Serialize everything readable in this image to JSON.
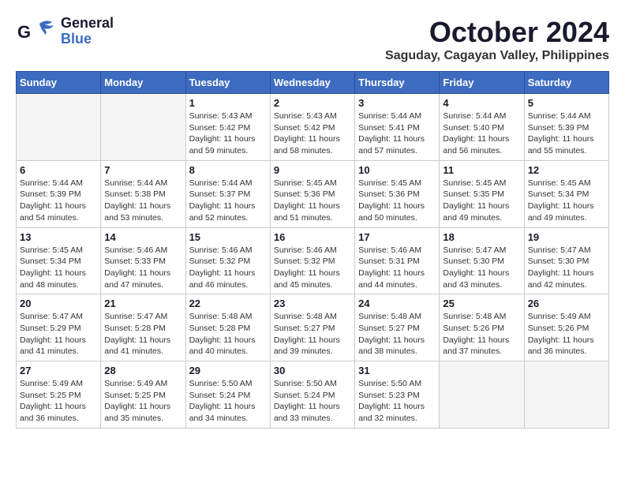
{
  "header": {
    "logo_line1": "General",
    "logo_line2": "Blue",
    "month_title": "October 2024",
    "location": "Saguday, Cagayan Valley, Philippines"
  },
  "weekdays": [
    "Sunday",
    "Monday",
    "Tuesday",
    "Wednesday",
    "Thursday",
    "Friday",
    "Saturday"
  ],
  "weeks": [
    [
      {
        "day": "",
        "sunrise": "",
        "sunset": "",
        "daylight": "",
        "empty": true
      },
      {
        "day": "",
        "sunrise": "",
        "sunset": "",
        "daylight": "",
        "empty": true
      },
      {
        "day": "1",
        "sunrise": "Sunrise: 5:43 AM",
        "sunset": "Sunset: 5:42 PM",
        "daylight": "Daylight: 11 hours and 59 minutes."
      },
      {
        "day": "2",
        "sunrise": "Sunrise: 5:43 AM",
        "sunset": "Sunset: 5:42 PM",
        "daylight": "Daylight: 11 hours and 58 minutes."
      },
      {
        "day": "3",
        "sunrise": "Sunrise: 5:44 AM",
        "sunset": "Sunset: 5:41 PM",
        "daylight": "Daylight: 11 hours and 57 minutes."
      },
      {
        "day": "4",
        "sunrise": "Sunrise: 5:44 AM",
        "sunset": "Sunset: 5:40 PM",
        "daylight": "Daylight: 11 hours and 56 minutes."
      },
      {
        "day": "5",
        "sunrise": "Sunrise: 5:44 AM",
        "sunset": "Sunset: 5:39 PM",
        "daylight": "Daylight: 11 hours and 55 minutes."
      }
    ],
    [
      {
        "day": "6",
        "sunrise": "Sunrise: 5:44 AM",
        "sunset": "Sunset: 5:39 PM",
        "daylight": "Daylight: 11 hours and 54 minutes."
      },
      {
        "day": "7",
        "sunrise": "Sunrise: 5:44 AM",
        "sunset": "Sunset: 5:38 PM",
        "daylight": "Daylight: 11 hours and 53 minutes."
      },
      {
        "day": "8",
        "sunrise": "Sunrise: 5:44 AM",
        "sunset": "Sunset: 5:37 PM",
        "daylight": "Daylight: 11 hours and 52 minutes."
      },
      {
        "day": "9",
        "sunrise": "Sunrise: 5:45 AM",
        "sunset": "Sunset: 5:36 PM",
        "daylight": "Daylight: 11 hours and 51 minutes."
      },
      {
        "day": "10",
        "sunrise": "Sunrise: 5:45 AM",
        "sunset": "Sunset: 5:36 PM",
        "daylight": "Daylight: 11 hours and 50 minutes."
      },
      {
        "day": "11",
        "sunrise": "Sunrise: 5:45 AM",
        "sunset": "Sunset: 5:35 PM",
        "daylight": "Daylight: 11 hours and 49 minutes."
      },
      {
        "day": "12",
        "sunrise": "Sunrise: 5:45 AM",
        "sunset": "Sunset: 5:34 PM",
        "daylight": "Daylight: 11 hours and 49 minutes."
      }
    ],
    [
      {
        "day": "13",
        "sunrise": "Sunrise: 5:45 AM",
        "sunset": "Sunset: 5:34 PM",
        "daylight": "Daylight: 11 hours and 48 minutes."
      },
      {
        "day": "14",
        "sunrise": "Sunrise: 5:46 AM",
        "sunset": "Sunset: 5:33 PM",
        "daylight": "Daylight: 11 hours and 47 minutes."
      },
      {
        "day": "15",
        "sunrise": "Sunrise: 5:46 AM",
        "sunset": "Sunset: 5:32 PM",
        "daylight": "Daylight: 11 hours and 46 minutes."
      },
      {
        "day": "16",
        "sunrise": "Sunrise: 5:46 AM",
        "sunset": "Sunset: 5:32 PM",
        "daylight": "Daylight: 11 hours and 45 minutes."
      },
      {
        "day": "17",
        "sunrise": "Sunrise: 5:46 AM",
        "sunset": "Sunset: 5:31 PM",
        "daylight": "Daylight: 11 hours and 44 minutes."
      },
      {
        "day": "18",
        "sunrise": "Sunrise: 5:47 AM",
        "sunset": "Sunset: 5:30 PM",
        "daylight": "Daylight: 11 hours and 43 minutes."
      },
      {
        "day": "19",
        "sunrise": "Sunrise: 5:47 AM",
        "sunset": "Sunset: 5:30 PM",
        "daylight": "Daylight: 11 hours and 42 minutes."
      }
    ],
    [
      {
        "day": "20",
        "sunrise": "Sunrise: 5:47 AM",
        "sunset": "Sunset: 5:29 PM",
        "daylight": "Daylight: 11 hours and 41 minutes."
      },
      {
        "day": "21",
        "sunrise": "Sunrise: 5:47 AM",
        "sunset": "Sunset: 5:28 PM",
        "daylight": "Daylight: 11 hours and 41 minutes."
      },
      {
        "day": "22",
        "sunrise": "Sunrise: 5:48 AM",
        "sunset": "Sunset: 5:28 PM",
        "daylight": "Daylight: 11 hours and 40 minutes."
      },
      {
        "day": "23",
        "sunrise": "Sunrise: 5:48 AM",
        "sunset": "Sunset: 5:27 PM",
        "daylight": "Daylight: 11 hours and 39 minutes."
      },
      {
        "day": "24",
        "sunrise": "Sunrise: 5:48 AM",
        "sunset": "Sunset: 5:27 PM",
        "daylight": "Daylight: 11 hours and 38 minutes."
      },
      {
        "day": "25",
        "sunrise": "Sunrise: 5:48 AM",
        "sunset": "Sunset: 5:26 PM",
        "daylight": "Daylight: 11 hours and 37 minutes."
      },
      {
        "day": "26",
        "sunrise": "Sunrise: 5:49 AM",
        "sunset": "Sunset: 5:26 PM",
        "daylight": "Daylight: 11 hours and 36 minutes."
      }
    ],
    [
      {
        "day": "27",
        "sunrise": "Sunrise: 5:49 AM",
        "sunset": "Sunset: 5:25 PM",
        "daylight": "Daylight: 11 hours and 36 minutes."
      },
      {
        "day": "28",
        "sunrise": "Sunrise: 5:49 AM",
        "sunset": "Sunset: 5:25 PM",
        "daylight": "Daylight: 11 hours and 35 minutes."
      },
      {
        "day": "29",
        "sunrise": "Sunrise: 5:50 AM",
        "sunset": "Sunset: 5:24 PM",
        "daylight": "Daylight: 11 hours and 34 minutes."
      },
      {
        "day": "30",
        "sunrise": "Sunrise: 5:50 AM",
        "sunset": "Sunset: 5:24 PM",
        "daylight": "Daylight: 11 hours and 33 minutes."
      },
      {
        "day": "31",
        "sunrise": "Sunrise: 5:50 AM",
        "sunset": "Sunset: 5:23 PM",
        "daylight": "Daylight: 11 hours and 32 minutes."
      },
      {
        "day": "",
        "sunrise": "",
        "sunset": "",
        "daylight": "",
        "empty": true
      },
      {
        "day": "",
        "sunrise": "",
        "sunset": "",
        "daylight": "",
        "empty": true
      }
    ]
  ]
}
